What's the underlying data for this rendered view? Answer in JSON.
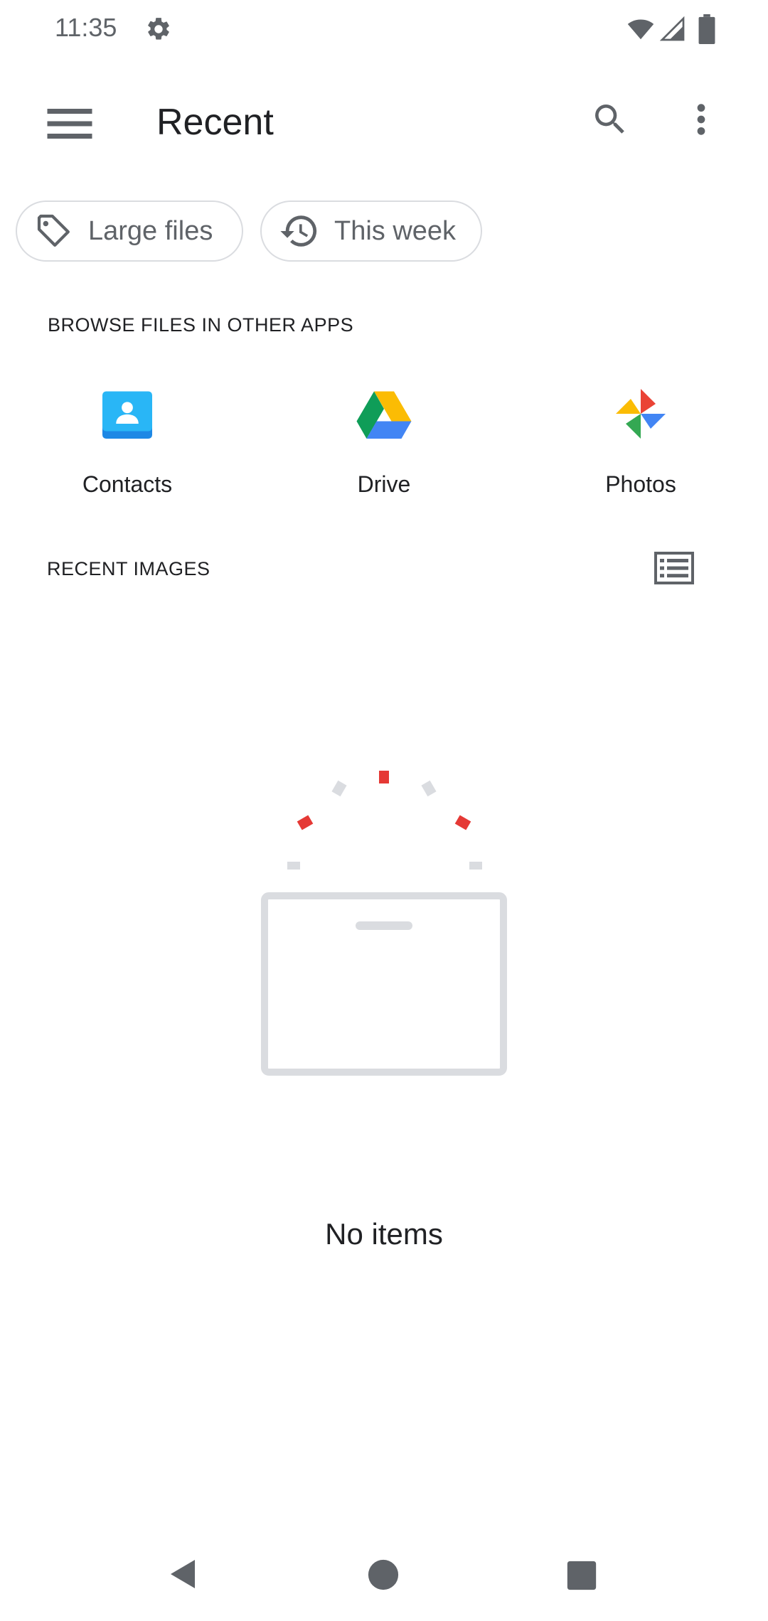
{
  "status_bar": {
    "time": "11:35",
    "icons": [
      "gear-icon",
      "wifi-icon",
      "signal-icon",
      "battery-icon"
    ]
  },
  "app_bar": {
    "title": "Recent",
    "icons": [
      "menu-icon",
      "search-icon",
      "more-vert-icon"
    ]
  },
  "chips": [
    {
      "label": "Large files",
      "icon": "tag-icon"
    },
    {
      "label": "This week",
      "icon": "history-icon"
    }
  ],
  "browse": {
    "heading": "BROWSE FILES IN OTHER APPS",
    "apps": [
      {
        "label": "Contacts",
        "icon": "contacts-app-icon"
      },
      {
        "label": "Drive",
        "icon": "drive-app-icon"
      },
      {
        "label": "Photos",
        "icon": "photos-app-icon"
      }
    ]
  },
  "recent_images": {
    "heading": "RECENT IMAGES",
    "view_toggle_icon": "list-view-icon",
    "empty_text": "No items"
  },
  "nav_bar": {
    "icons": [
      "back-icon",
      "home-icon",
      "recents-icon"
    ]
  },
  "colors": {
    "accent_red": "#e53935",
    "illustration_gray": "#dadce0",
    "text_primary": "#202124",
    "text_secondary": "#5f6368"
  }
}
